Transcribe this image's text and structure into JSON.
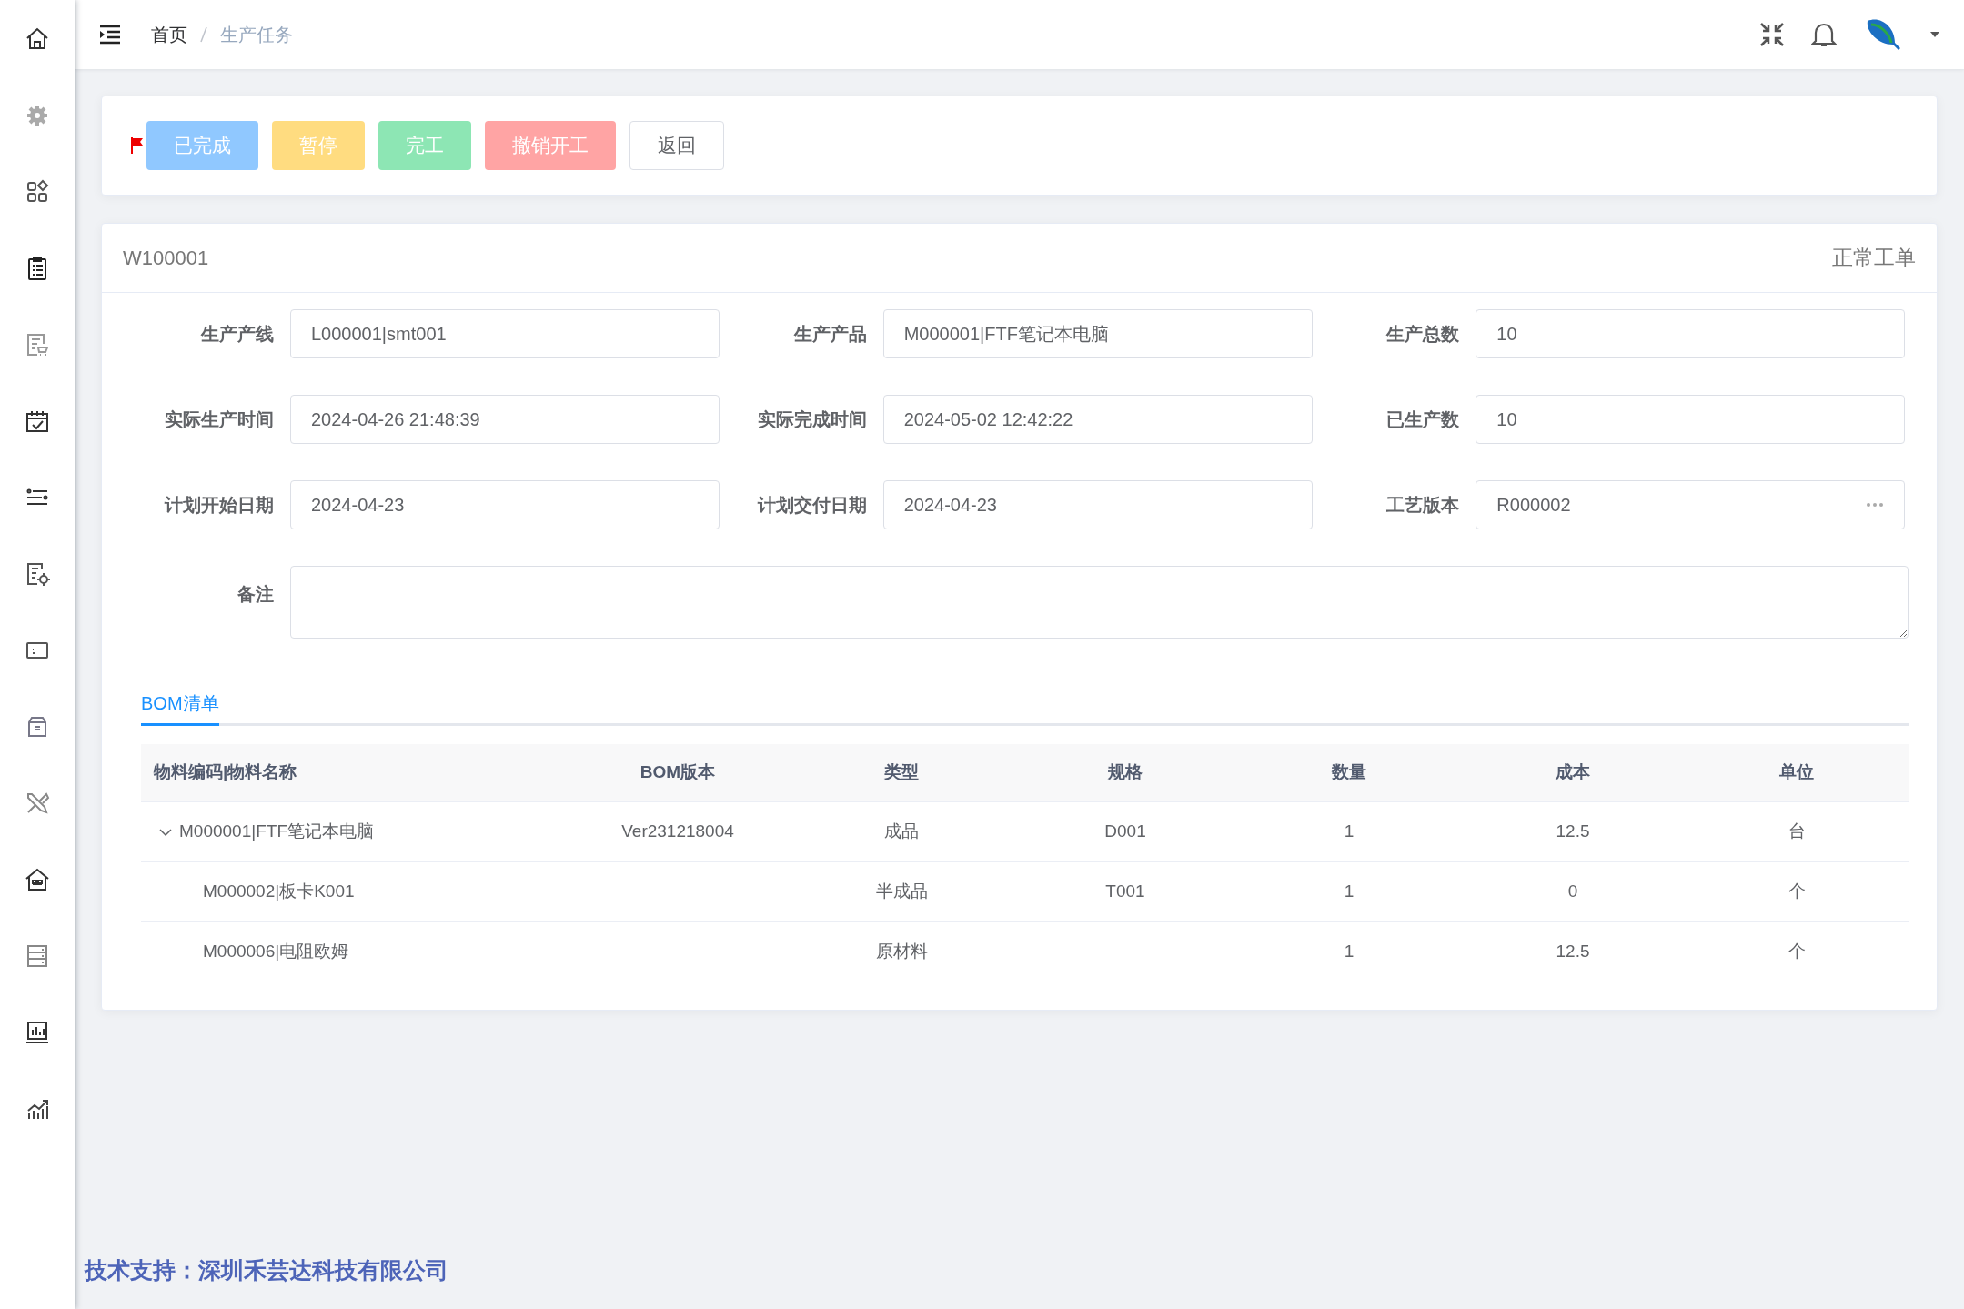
{
  "breadcrumb": [
    {
      "label": "首页",
      "current": false
    },
    {
      "label": "生产任务",
      "current": true
    }
  ],
  "actions": [
    {
      "label": "已完成",
      "kind": "info"
    },
    {
      "label": "暂停",
      "kind": "warning"
    },
    {
      "label": "完工",
      "kind": "success"
    },
    {
      "label": "撤销开工",
      "kind": "danger"
    },
    {
      "label": "返回",
      "kind": "default"
    }
  ],
  "order": {
    "code": "W100001",
    "type": "正常工单"
  },
  "form": {
    "fields": [
      {
        "label": "生产产线",
        "value": "L000001|smt001",
        "kind": "text"
      },
      {
        "label": "生产产品",
        "value": "M000001|FTF笔记本电脑",
        "kind": "text"
      },
      {
        "label": "生产总数",
        "value": "10",
        "kind": "text"
      },
      {
        "label": "实际生产时间",
        "value": "2024-04-26 21:48:39",
        "kind": "text"
      },
      {
        "label": "实际完成时间",
        "value": "2024-05-02 12:42:22",
        "kind": "text"
      },
      {
        "label": "已生产数",
        "value": "10",
        "kind": "text"
      },
      {
        "label": "计划开始日期",
        "value": "2024-04-23",
        "kind": "text"
      },
      {
        "label": "计划交付日期",
        "value": "2024-04-23",
        "kind": "text"
      },
      {
        "label": "工艺版本",
        "value": "R000002",
        "kind": "picker"
      }
    ],
    "remark": {
      "label": "备注"
    }
  },
  "tabs": [
    {
      "label": "BOM清单",
      "selected": true
    }
  ],
  "table": {
    "columns": [
      "物料编码|物料名称",
      "BOM版本",
      "类型",
      "规格",
      "数量",
      "成本",
      "单位"
    ],
    "rows": [
      {
        "cells": [
          "M000001|FTF笔记本电脑",
          "Ver231218004",
          "成品",
          "D001",
          "1",
          "12.5",
          "台"
        ],
        "expanded": true,
        "children": [
          {
            "cells": [
              "M000002|板卡K001",
              "",
              "半成品",
              "T001",
              "1",
              "0",
              "个"
            ]
          },
          {
            "cells": [
              "M000006|电阻欧姆",
              "",
              "原材料",
              "",
              "1",
              "12.5",
              "个"
            ]
          }
        ]
      }
    ]
  },
  "footer": "技术支持：深圳禾芸达科技有限公司"
}
